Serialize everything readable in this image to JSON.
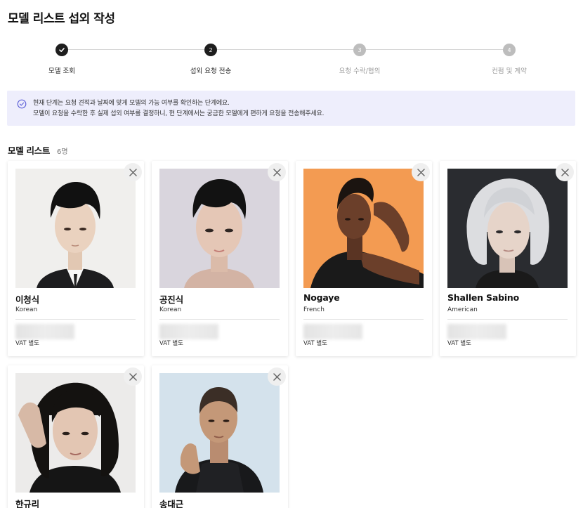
{
  "page": {
    "title": "모델 리스트 섭외 작성"
  },
  "stepper": {
    "steps": [
      {
        "number": "1",
        "label": "모델 조회",
        "state": "done"
      },
      {
        "number": "2",
        "label": "섭외 요청 전송",
        "state": "active"
      },
      {
        "number": "3",
        "label": "요청 수락/협의",
        "state": "pending"
      },
      {
        "number": "4",
        "label": "컨펌 및 계약",
        "state": "pending"
      }
    ]
  },
  "info": {
    "line1": "현재 단계는 요청 견적과 날짜에 맞게 모델의 가능 여부를 확인하는 단계에요.",
    "line2": "모델이 요청을 수락한 후 실제 섭외 여부를 결정하니, 현 단계에서는 궁금한 모델에게 편하게 요청을 전송해주세요."
  },
  "model_list": {
    "title": "모델 리스트",
    "count": "6명",
    "models": [
      {
        "name": "이청식",
        "nationality": "Korean",
        "vat": "VAT 별도"
      },
      {
        "name": "공진식",
        "nationality": "Korean",
        "vat": "VAT 별도"
      },
      {
        "name": "Nogaye",
        "nationality": "French",
        "vat": "VAT 별도"
      },
      {
        "name": "Shallen Sabino",
        "nationality": "American",
        "vat": "VAT 별도"
      },
      {
        "name": "한규리",
        "nationality": "",
        "vat": ""
      },
      {
        "name": "송대근",
        "nationality": "",
        "vat": ""
      }
    ]
  },
  "colors": {
    "info_bg": "#eeeefc",
    "info_icon": "#6366d9",
    "step_done": "#1e1e1e",
    "step_pending": "#bdbdbd"
  },
  "icons": {
    "step_done": "check-icon",
    "info": "check-circle-icon",
    "remove": "close-icon"
  }
}
